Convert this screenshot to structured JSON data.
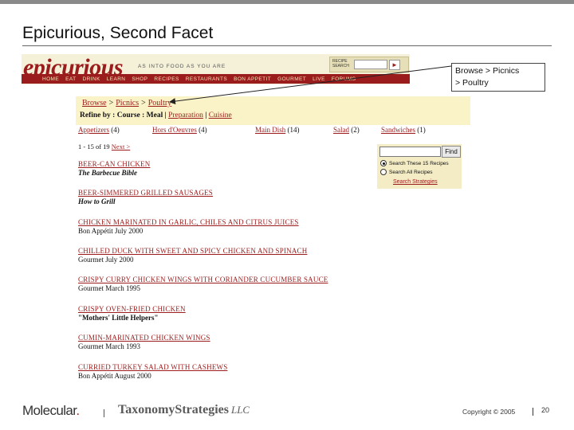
{
  "slide": {
    "title": "Epicurious, Second Facet"
  },
  "site": {
    "logo": "epicurious",
    "tagline": "AS INTO FOOD AS YOU ARE",
    "search_label": "RECIPE SEARCH",
    "search_go": "►",
    "nav": [
      "HOME",
      "EAT",
      "DRINK",
      "LEARN",
      "SHOP",
      "RECIPES",
      "RESTAURANTS",
      "BON APPETIT",
      "GOURMET",
      "LIVE",
      "FORUMS"
    ]
  },
  "browse": {
    "crumbs": [
      "Browse",
      "Picnics",
      "Poultry"
    ],
    "crumb_sep": ">",
    "refine_label": "Refine by : Course : Meal |",
    "refine_link1": "Preparation",
    "refine_sep": "|",
    "refine_link2": "Cuisine",
    "categories": [
      {
        "label": "Appetizers",
        "count": "(4)"
      },
      {
        "label": "Hors d'Oeuvres",
        "count": "(4)"
      },
      {
        "label": "Main Dish",
        "count": "(14)"
      },
      {
        "label": "Salad",
        "count": "(2)"
      },
      {
        "label": "Sandwiches",
        "count": "(1)"
      }
    ],
    "count_text": "1 - 15 of 19",
    "next_label": "Next >"
  },
  "recipes": [
    {
      "title": "BEER-CAN CHICKEN",
      "source": "The Barbecue Bible",
      "style": "it"
    },
    {
      "title": "BEER-SIMMERED GRILLED SAUSAGES",
      "source": "How to Grill",
      "style": "it"
    },
    {
      "title": "CHICKEN MARINATED IN GARLIC, CHILES AND CITRUS JUICES",
      "source": "Bon Appétit   July 2000",
      "style": ""
    },
    {
      "title": "CHILLED DUCK WITH SWEET AND SPICY CHICKEN AND SPINACH",
      "source": "Gourmet   July 2000",
      "style": ""
    },
    {
      "title": "CRISPY CURRY CHICKEN WINGS WITH CORIANDER CUCUMBER SAUCE",
      "source": "Gourmet   March 1995",
      "style": ""
    },
    {
      "title": "CRISPY OVEN-FRIED CHICKEN",
      "source": "\"Mothers' Little Helpers\"",
      "style": "bd"
    },
    {
      "title": "CUMIN-MARINATED CHICKEN WINGS",
      "source": "Gourmet   March 1993",
      "style": ""
    },
    {
      "title": "CURRIED TURKEY SALAD WITH CASHEWS",
      "source": "Bon Appétit   August 2000",
      "style": ""
    }
  ],
  "find": {
    "button": "Find",
    "option1": "Search These 15 Recipes",
    "option2": "Search All Recipes",
    "strategies": "Search Strategies"
  },
  "callout": {
    "line1": "Browse > Picnics",
    "line2": "> Poultry"
  },
  "footer": {
    "molecular": "Molecular",
    "molecular_dot": ".",
    "taxonomy": "TaxonomyStrategies",
    "llc": "LLC",
    "copyright": "Copyright © 2005",
    "page": "20"
  },
  "colors": {
    "brand_red": "#9b1c1c",
    "panel_cream": "#fbf3c8"
  }
}
